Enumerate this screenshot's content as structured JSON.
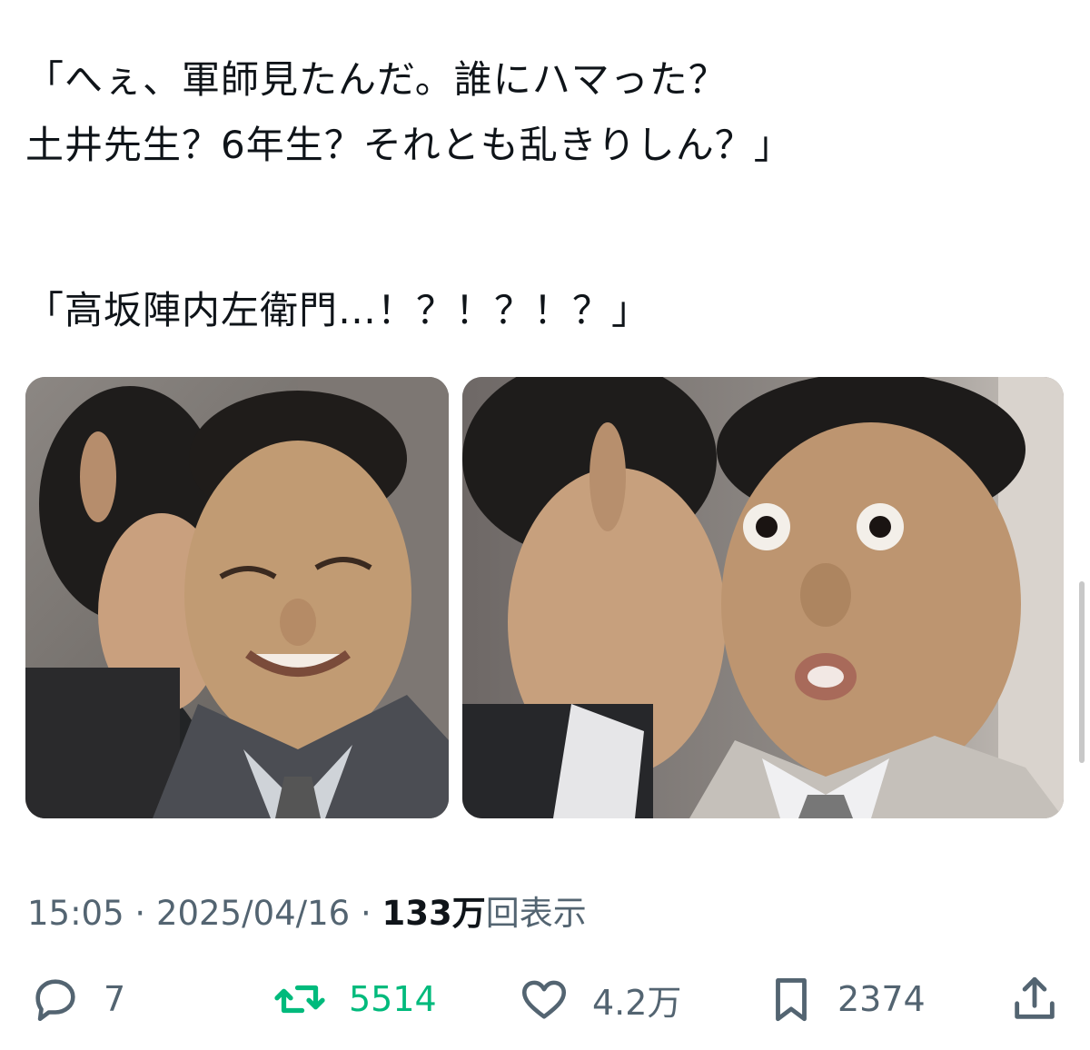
{
  "tweet": {
    "lines": [
      "「へぇ、軍師見たんだ。誰にハマった？",
      "土井先生？6年生？それとも乱きりしん？」",
      "「高坂陣内左衛門…！？！？！？」"
    ]
  },
  "media": [
    {
      "icon": "photo-smiling-man"
    },
    {
      "icon": "photo-surprised-man"
    }
  ],
  "meta": {
    "time": "15:05",
    "separator": "·",
    "date": "2025/04/16",
    "views_count": "133万",
    "views_label": "回表示"
  },
  "actions": {
    "reply_count": "7",
    "retweet_count": "5514",
    "like_count": "4.2万",
    "bookmark_count": "2374",
    "colors": {
      "muted": "#536471",
      "retweet": "#00ba7c"
    }
  }
}
